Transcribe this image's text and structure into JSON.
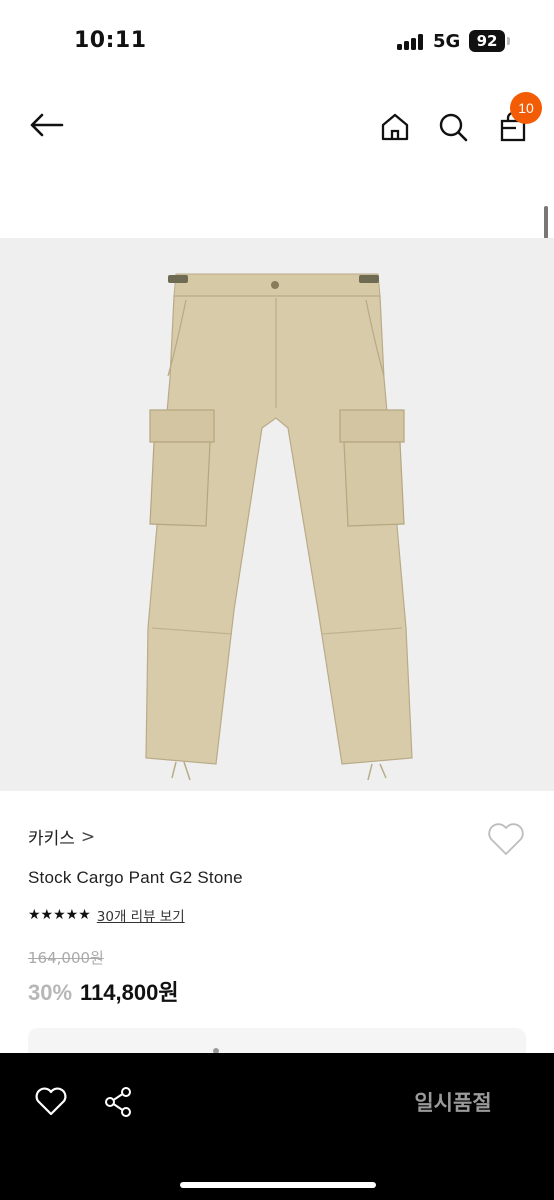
{
  "status_bar": {
    "time": "10:11",
    "network": "5G",
    "battery": "92"
  },
  "header": {
    "cart_count": "10"
  },
  "product": {
    "brand": "카키스",
    "brand_chevron": ">",
    "name": "Stock Cargo Pant G2 Stone",
    "stars": "★★★★★",
    "review_link": "30개 리뷰 보기",
    "original_price": "164,000원",
    "discount": "30%",
    "sale_price": "114,800원",
    "image_color": "#d8cbaa"
  },
  "bottom_bar": {
    "action_label": "일시품절"
  },
  "colors": {
    "accent": "#f25c05",
    "background_image": "#efeff0"
  }
}
